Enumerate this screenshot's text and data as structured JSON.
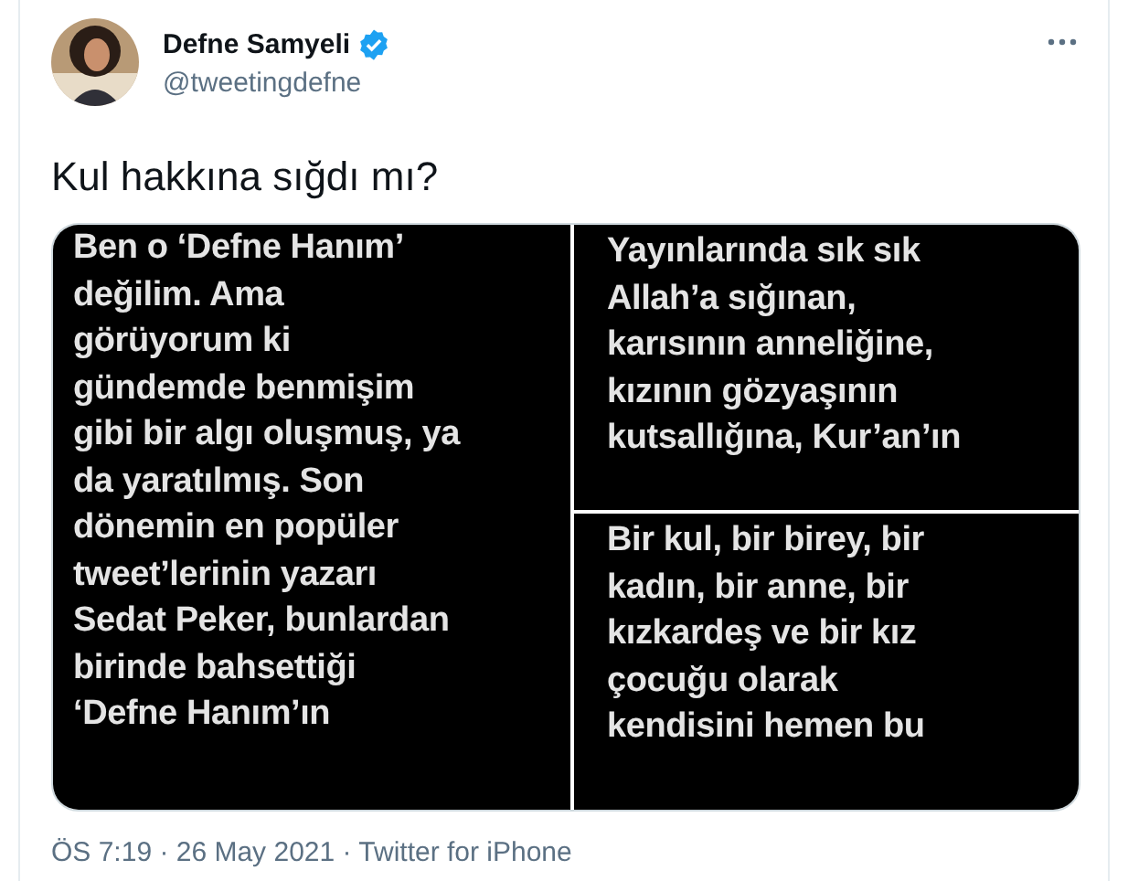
{
  "author": {
    "name": "Defne Samyeli",
    "verified": true,
    "handle": "@tweetingdefne"
  },
  "text": "Kul hakkına sığdı mı?",
  "media": [
    {
      "text": "Ben o ‘Defne Hanım’\ndeğilim. Ama\ngörüyorum ki\ngündemde benmişim\ngibi bir algı oluşmuş, ya\nda yaratılmış. Son\ndönemin en popüler\ntweet’lerinin yazarı\nSedat Peker, bunlardan\nbirinde bahsettiği\n‘Defne Hanım’ın"
    },
    {
      "text": "Yayınlarında sık sık\nAllah’a sığınan,\nkarısının anneliğine,\nkızının gözyaşının\nkutsallığına, Kur’an’ın"
    },
    {
      "text": "Bir kul, bir birey, bir\nkadın, bir anne, bir\nkızkardeş ve bir kız\nçocuğu olarak\nkendisini hemen bu"
    }
  ],
  "meta": "ÖS 7:19 · 26 May 2021 · Twitter for iPhone"
}
